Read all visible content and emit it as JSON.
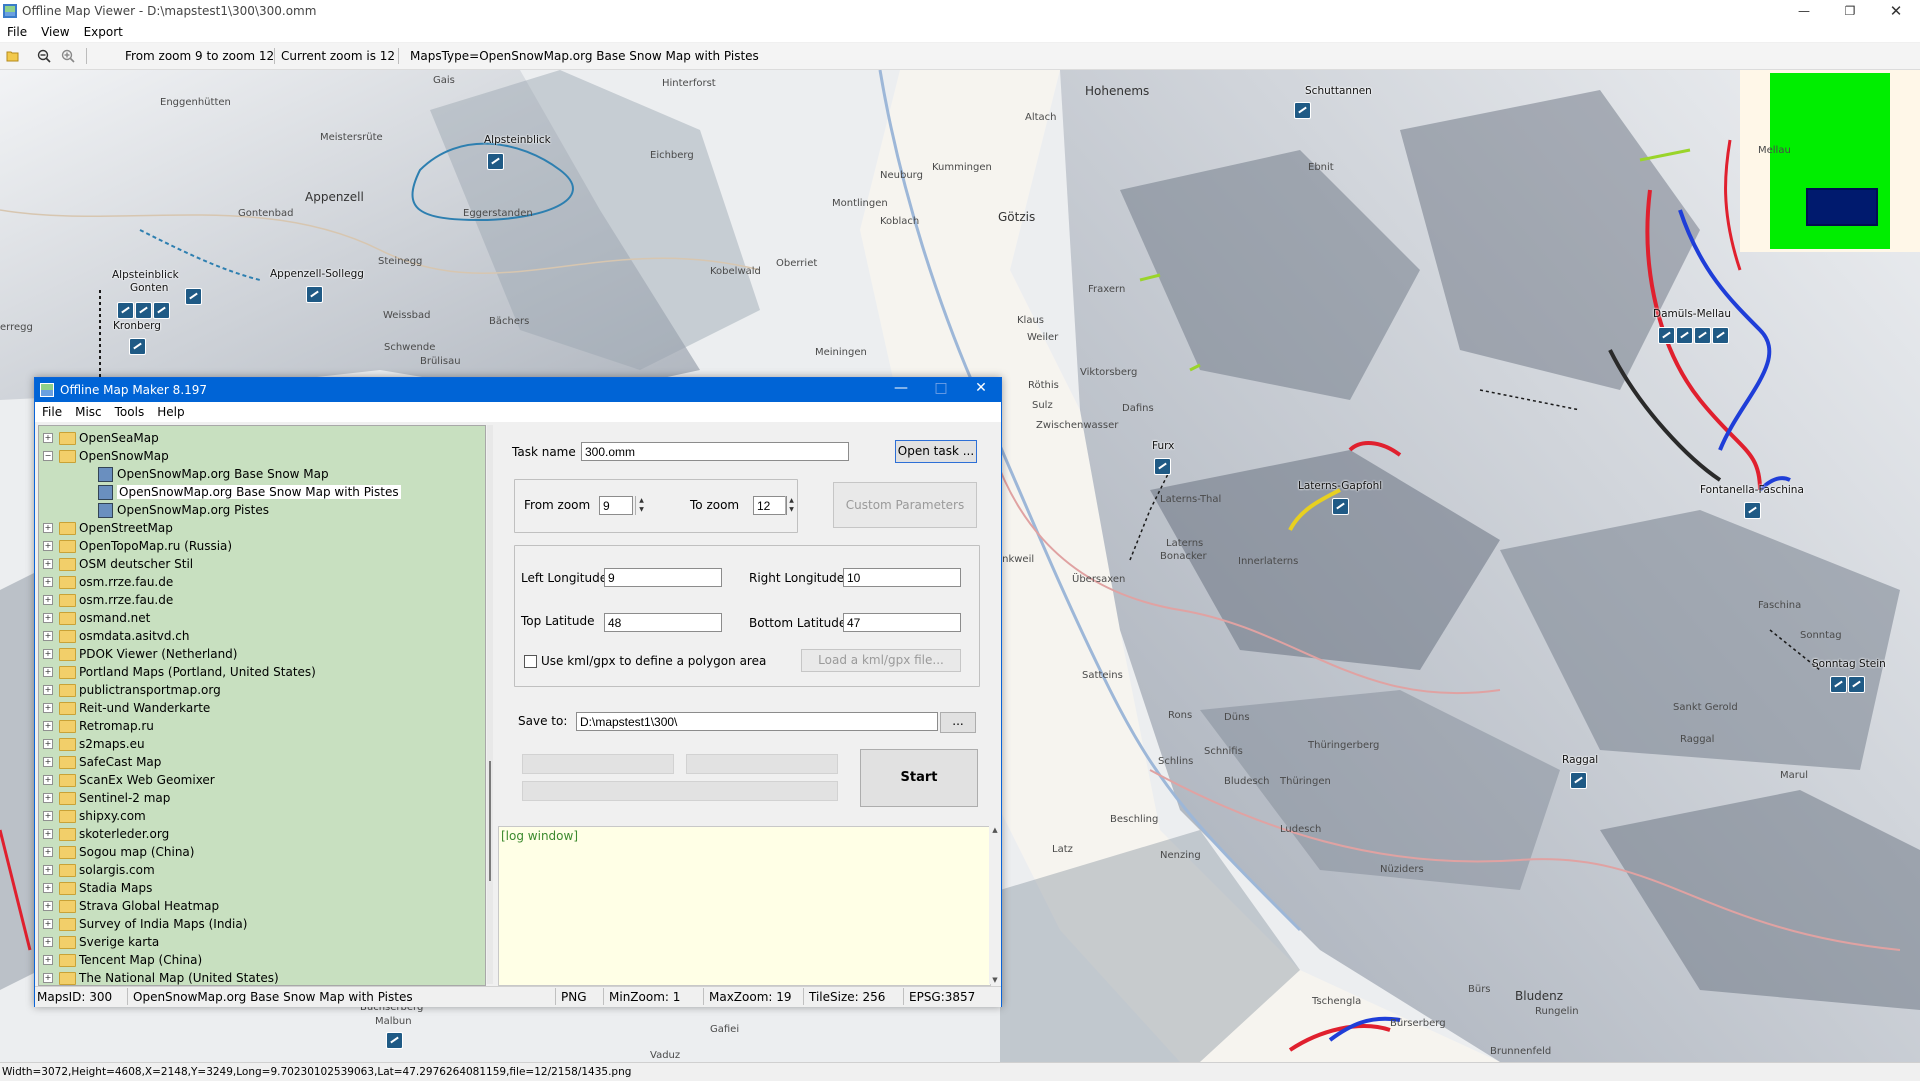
{
  "viewer": {
    "title": "Offline Map Viewer - D:\\mapstest1\\300\\300.omm",
    "menu": [
      "File",
      "View",
      "Export"
    ],
    "toolbar": {
      "zoom_range": "From zoom 9 to zoom 12",
      "current_zoom": "Current zoom is 12",
      "maps_type": "MapsType=OpenSnowMap.org Base Snow Map with Pistes"
    },
    "status": "Width=3072,Height=4608,X=2148,Y=3249,Long=9.70230102539063,Lat=47.2976264081159,file=12/2158/1435.png"
  },
  "map": {
    "towns": [
      "Hohenems",
      "Götzis",
      "Appenzell",
      "Bludenz"
    ],
    "places": [
      "Gais",
      "Hinterforst",
      "Enggenhütten",
      "Meistersrüte",
      "Eichberg",
      "Altach",
      "Neuburg",
      "Kummingen",
      "Montlingen",
      "Koblach",
      "Gontenbad",
      "Eggerstanden",
      "Kobelwald",
      "Oberriet",
      "Steinegg",
      "Weissbad",
      "Bächers",
      "Schwende",
      "Brülisau",
      "Meiningen",
      "Fraxern",
      "Klaus",
      "Weiler",
      "Viktorsberg",
      "Röthis",
      "Sulz",
      "Dafins",
      "Zwischenwasser",
      "Laterns-Thal",
      "Laterns",
      "Bonacker",
      "Innerlaterns",
      "Übersaxen",
      "Satteins",
      "Rons",
      "Düns",
      "Schnifis",
      "Schlins",
      "Thüringerberg",
      "Bludesch",
      "Thüringen",
      "Beschling",
      "Latz",
      "Nenzing",
      "Ludesch",
      "Nüziders",
      "Bürs",
      "Brunnenfeld",
      "Rungelin",
      "Tschengla",
      "Gafiei",
      "Vaduz",
      "Faschina",
      "Sonntag",
      "Sankt Gerold",
      "Raggal",
      "Marul",
      "Ebnit",
      "Mellau",
      "Buchserberg",
      "Malbun",
      "Bürserberg",
      "erregg",
      "ankweil"
    ],
    "resorts": [
      "Schuttannen",
      "Alpsteinblick",
      "Gonten",
      "Appenzell-Sollegg",
      "Kronberg",
      "Damüls-Mellau",
      "Furx",
      "Laterns-Gapfohl",
      "Fontanella-Faschina",
      "Sonntag Stein",
      "Raggal"
    ],
    "overview_colors": {
      "viewport": "#001a6e",
      "coverage": "#00ee00"
    }
  },
  "dialog": {
    "title": "Offline Map Maker 8.197",
    "menu": [
      "File",
      "Misc",
      "Tools",
      "Help"
    ],
    "tree": [
      {
        "label": "OpenSeaMap",
        "level": 0,
        "type": "folder",
        "expanded": false
      },
      {
        "label": "OpenSnowMap",
        "level": 0,
        "type": "folder",
        "expanded": true
      },
      {
        "label": "OpenSnowMap.org Base Snow Map",
        "level": 1,
        "type": "map"
      },
      {
        "label": "OpenSnowMap.org Base Snow Map with Pistes",
        "level": 1,
        "type": "map",
        "selected": true
      },
      {
        "label": "OpenSnowMap.org Pistes",
        "level": 1,
        "type": "map"
      },
      {
        "label": "OpenStreetMap",
        "level": 0,
        "type": "folder"
      },
      {
        "label": "OpenTopoMap.ru (Russia)",
        "level": 0,
        "type": "folder"
      },
      {
        "label": "OSM deutscher Stil",
        "level": 0,
        "type": "folder"
      },
      {
        "label": "osm.rrze.fau.de",
        "level": 0,
        "type": "folder"
      },
      {
        "label": "osm.rrze.fau.de",
        "level": 0,
        "type": "folder"
      },
      {
        "label": "osmand.net",
        "level": 0,
        "type": "folder"
      },
      {
        "label": "osmdata.asitvd.ch",
        "level": 0,
        "type": "folder"
      },
      {
        "label": "PDOK Viewer (Netherland)",
        "level": 0,
        "type": "folder"
      },
      {
        "label": "Portland Maps (Portland, United States)",
        "level": 0,
        "type": "folder"
      },
      {
        "label": "publictransportmap.org",
        "level": 0,
        "type": "folder"
      },
      {
        "label": "Reit-und Wanderkarte",
        "level": 0,
        "type": "folder"
      },
      {
        "label": "Retromap.ru",
        "level": 0,
        "type": "folder"
      },
      {
        "label": "s2maps.eu",
        "level": 0,
        "type": "folder"
      },
      {
        "label": "SafeCast Map",
        "level": 0,
        "type": "folder"
      },
      {
        "label": "ScanEx Web Geomixer",
        "level": 0,
        "type": "folder"
      },
      {
        "label": "Sentinel-2 map",
        "level": 0,
        "type": "folder"
      },
      {
        "label": "shipxy.com",
        "level": 0,
        "type": "folder"
      },
      {
        "label": "skoterleder.org",
        "level": 0,
        "type": "folder"
      },
      {
        "label": "Sogou map (China)",
        "level": 0,
        "type": "folder"
      },
      {
        "label": "solargis.com",
        "level": 0,
        "type": "folder"
      },
      {
        "label": "Stadia Maps",
        "level": 0,
        "type": "folder"
      },
      {
        "label": "Strava Global Heatmap",
        "level": 0,
        "type": "folder"
      },
      {
        "label": "Survey of India Maps (India)",
        "level": 0,
        "type": "folder"
      },
      {
        "label": "Sverige karta",
        "level": 0,
        "type": "folder"
      },
      {
        "label": "Tencent Map (China)",
        "level": 0,
        "type": "folder"
      },
      {
        "label": "The National Map (United States)",
        "level": 0,
        "type": "folder"
      }
    ],
    "task_name_label": "Task name",
    "task_name_value": "300.omm",
    "open_task": "Open task ...",
    "from_zoom_label": "From zoom",
    "from_zoom_value": "9",
    "to_zoom_label": "To zoom",
    "to_zoom_value": "12",
    "custom_parameters": "Custom Parameters",
    "left_longitude_label": "Left Longitude",
    "left_longitude_value": "9",
    "right_longitude_label": "Right Longitude",
    "right_longitude_value": "10",
    "top_latitude_label": "Top Latitude",
    "top_latitude_value": "48",
    "bottom_latitude_label": "Bottom Latitude",
    "bottom_latitude_value": "47",
    "kml_checkbox_label": "Use kml/gpx to define a polygon area",
    "kml_checked": false,
    "load_kml": "Load a kml/gpx file...",
    "save_to_label": "Save to:",
    "save_to_value": "D:\\mapstest1\\300\\",
    "browse": "...",
    "start": "Start",
    "log_text": "[log window]",
    "status": {
      "maps_id": "MapsID: 300",
      "map_name": "OpenSnowMap.org Base Snow Map with Pistes",
      "format": "PNG",
      "min_zoom": "MinZoom: 1",
      "max_zoom": "MaxZoom: 19",
      "tile_size": "TileSize: 256",
      "epsg": "EPSG:3857"
    }
  }
}
